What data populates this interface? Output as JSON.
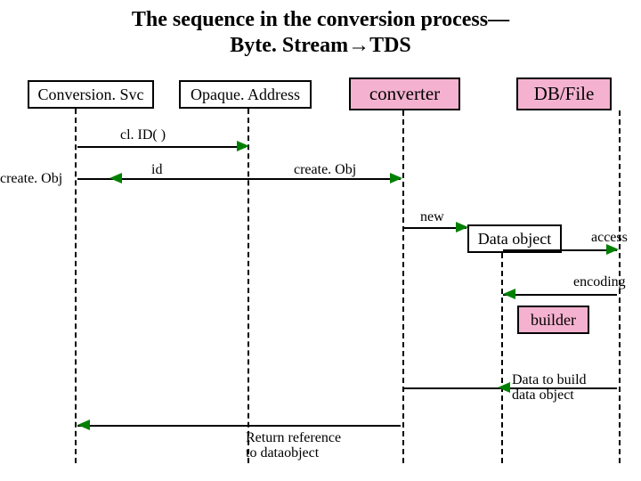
{
  "title_line1": "The sequence in the conversion process—",
  "title_line2": "Byte. Stream→TDS",
  "boxes": {
    "conversion_svc": "Conversion. Svc",
    "opaque_address": "Opaque. Address",
    "converter": "converter",
    "db_file": "DB/File",
    "data_object": "Data object",
    "builder": "builder"
  },
  "messages": {
    "clid": "cl. ID( )",
    "id": "id",
    "create_obj_left": "create. Obj",
    "create_obj_mid": "create. Obj",
    "new": "new",
    "access": "access",
    "encoding": "encoding",
    "data_to_build1": "Data to build",
    "data_to_build2": "data object",
    "return_ref1": "Return reference",
    "return_ref2": "to dataobject"
  }
}
